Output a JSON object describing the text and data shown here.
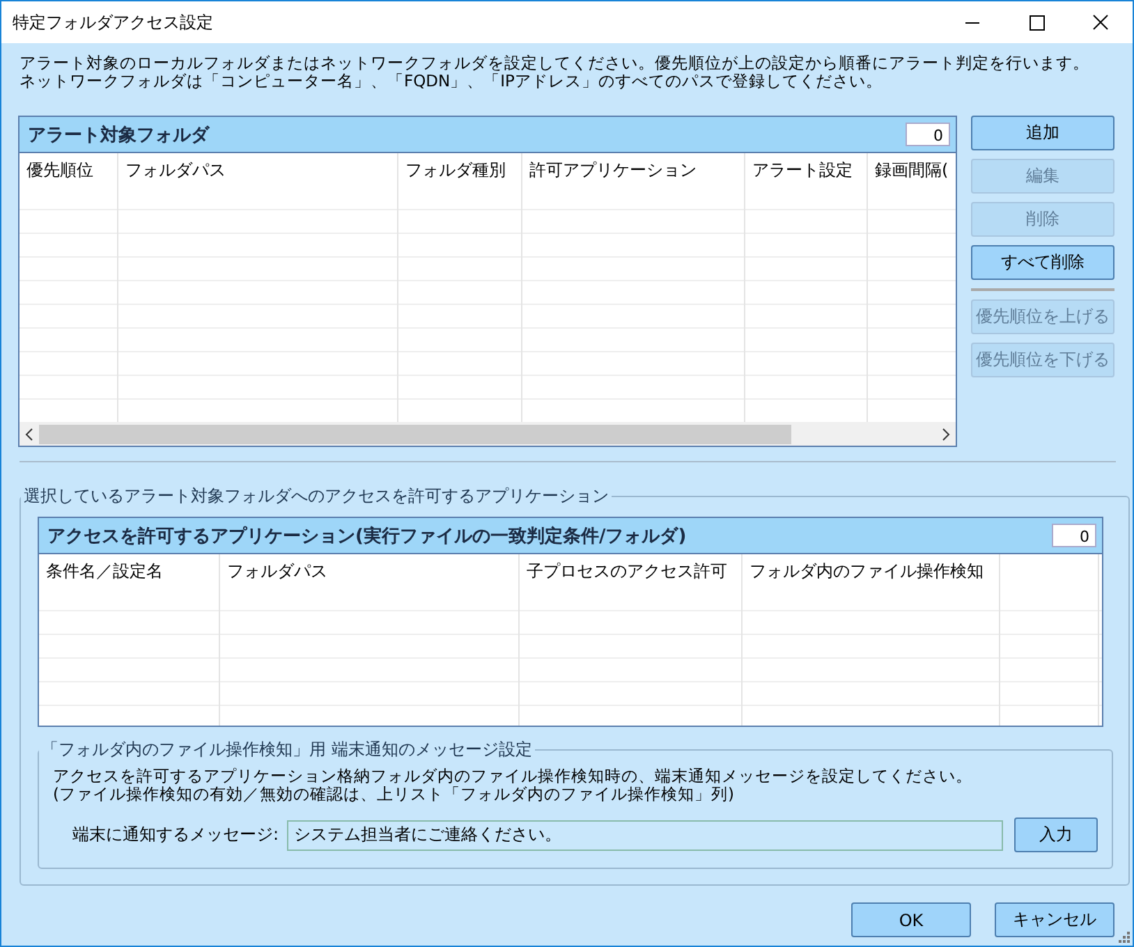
{
  "window": {
    "title": "特定フォルダアクセス設定"
  },
  "description": [
    "アラート対象のローカルフォルダまたはネットワークフォルダを設定してください。優先順位が上の設定から順番にアラート判定を行います。",
    "ネットワークフォルダは「コンピューター名」、「FQDN」、「IPアドレス」のすべてのパスで登録してください。"
  ],
  "folder_table": {
    "title": "アラート対象フォルダ",
    "count": "0",
    "columns": [
      "優先順位",
      "フォルダパス",
      "フォルダ種別",
      "許可アプリケーション",
      "アラート設定",
      "録画間隔("
    ]
  },
  "action_buttons": [
    {
      "label": "追加",
      "disabled": false
    },
    {
      "label": "編集",
      "disabled": true
    },
    {
      "label": "削除",
      "disabled": true
    },
    {
      "label": "すべて削除",
      "disabled": false
    }
  ],
  "priority_buttons": [
    {
      "label": "優先順位を上げる",
      "disabled": true
    },
    {
      "label": "優先順位を下げる",
      "disabled": true
    }
  ],
  "app_group": {
    "title": "選択しているアラート対象フォルダへのアクセスを許可するアプリケーション",
    "app_table": {
      "title": "アクセスを許可するアプリケーション(実行ファイルの一致判定条件/フォルダ)",
      "count": "0",
      "columns": [
        "条件名／設定名",
        "フォルダパス",
        "子プロセスのアクセス許可",
        "フォルダ内のファイル操作検知",
        ""
      ]
    },
    "message_group": {
      "title": "「フォルダ内のファイル操作検知」用 端末通知のメッセージ設定",
      "notes": [
        "アクセスを許可するアプリケーション格納フォルダ内のファイル操作検知時の、端末通知メッセージを設定してください。",
        "(ファイル操作検知の有効／無効の確認は、上リスト「フォルダ内のファイル操作検知」列)"
      ],
      "field_label": "端末に通知するメッセージ:",
      "field_value": "システム担当者にご連絡ください。",
      "input_button": "入力"
    }
  },
  "footer_buttons": [
    "OK",
    "キャンセル"
  ]
}
